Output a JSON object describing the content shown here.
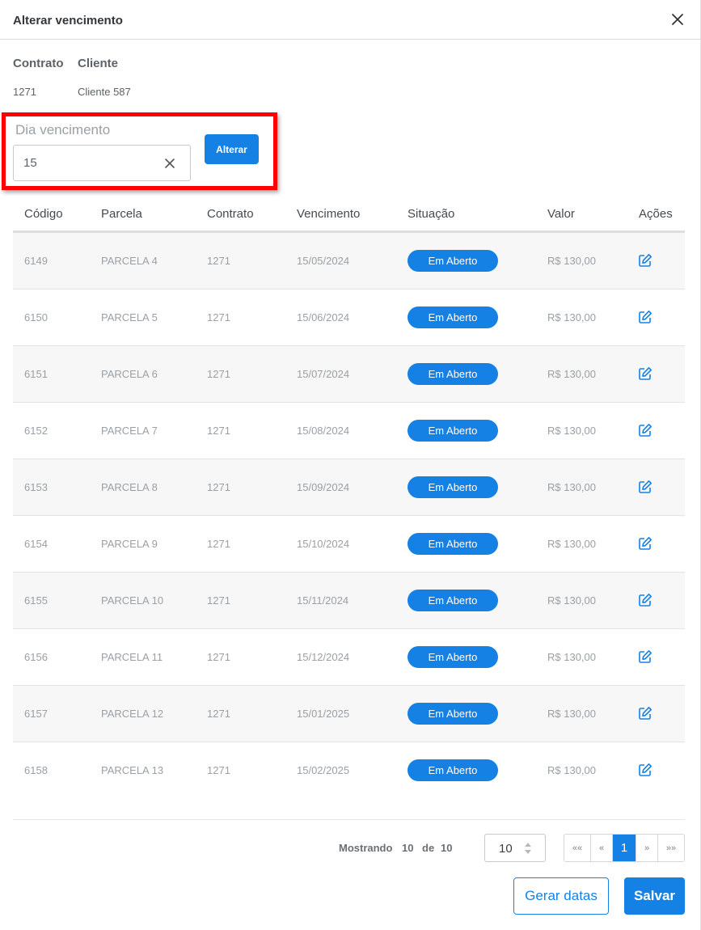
{
  "modal": {
    "title": "Alterar vencimento"
  },
  "info": {
    "contrato_label": "Contrato",
    "cliente_label": "Cliente",
    "contrato_value": "1271",
    "cliente_value": "Cliente 587"
  },
  "due_field": {
    "label": "Dia vencimento",
    "value": "15",
    "apply_label": "Alterar"
  },
  "table": {
    "headers": [
      "Código",
      "Parcela",
      "Contrato",
      "Vencimento",
      "Situação",
      "Valor",
      "Ações"
    ],
    "rows": [
      {
        "codigo": "6149",
        "parcela": "PARCELA 4",
        "contrato": "1271",
        "vencimento": "15/05/2024",
        "situacao": "Em Aberto",
        "valor": "R$ 130,00"
      },
      {
        "codigo": "6150",
        "parcela": "PARCELA 5",
        "contrato": "1271",
        "vencimento": "15/06/2024",
        "situacao": "Em Aberto",
        "valor": "R$ 130,00"
      },
      {
        "codigo": "6151",
        "parcela": "PARCELA 6",
        "contrato": "1271",
        "vencimento": "15/07/2024",
        "situacao": "Em Aberto",
        "valor": "R$ 130,00"
      },
      {
        "codigo": "6152",
        "parcela": "PARCELA 7",
        "contrato": "1271",
        "vencimento": "15/08/2024",
        "situacao": "Em Aberto",
        "valor": "R$ 130,00"
      },
      {
        "codigo": "6153",
        "parcela": "PARCELA 8",
        "contrato": "1271",
        "vencimento": "15/09/2024",
        "situacao": "Em Aberto",
        "valor": "R$ 130,00"
      },
      {
        "codigo": "6154",
        "parcela": "PARCELA 9",
        "contrato": "1271",
        "vencimento": "15/10/2024",
        "situacao": "Em Aberto",
        "valor": "R$ 130,00"
      },
      {
        "codigo": "6155",
        "parcela": "PARCELA 10",
        "contrato": "1271",
        "vencimento": "15/11/2024",
        "situacao": "Em Aberto",
        "valor": "R$ 130,00"
      },
      {
        "codigo": "6156",
        "parcela": "PARCELA 11",
        "contrato": "1271",
        "vencimento": "15/12/2024",
        "situacao": "Em Aberto",
        "valor": "R$ 130,00"
      },
      {
        "codigo": "6157",
        "parcela": "PARCELA 12",
        "contrato": "1271",
        "vencimento": "15/01/2025",
        "situacao": "Em Aberto",
        "valor": "R$ 130,00"
      },
      {
        "codigo": "6158",
        "parcela": "PARCELA 13",
        "contrato": "1271",
        "vencimento": "15/02/2025",
        "situacao": "Em Aberto",
        "valor": "R$ 130,00"
      }
    ],
    "action_icon": "edit-icon"
  },
  "pagination": {
    "showing_prefix": "Mostrando",
    "showing_from": "10",
    "showing_of": "de",
    "showing_total": "10",
    "per_page": "10",
    "first": "««",
    "prev": "«",
    "current": "1",
    "next": "»",
    "last": "»»"
  },
  "actions": {
    "generate_label": "Gerar datas",
    "save_label": "Salvar"
  },
  "colors": {
    "accent": "#1681e4",
    "highlight": "#ff0000"
  }
}
